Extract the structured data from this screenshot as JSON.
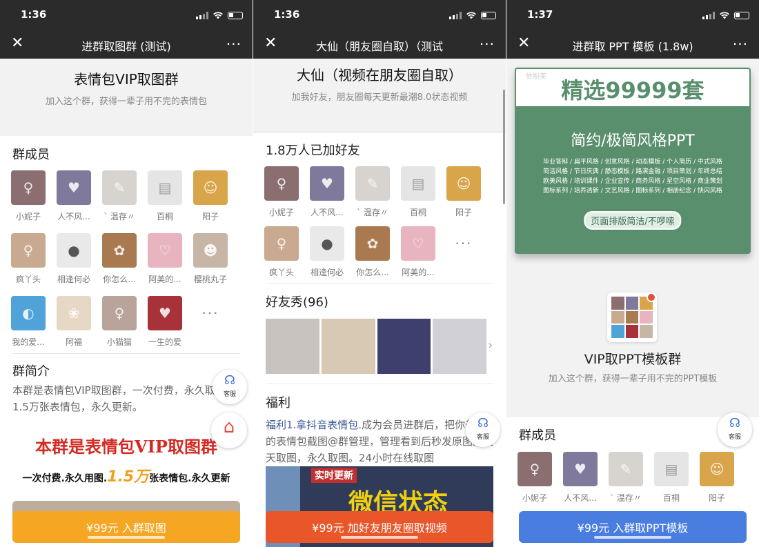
{
  "phones": [
    {
      "time": "1:36",
      "title": "进群取图群 (测试)",
      "hero_title": "表情包VIP取图群",
      "hero_sub": "加入这个群，获得一辈子用不完的表情包",
      "members_heading": "群成员",
      "members": [
        "小妮子",
        "人不风...",
        "` 温存〃",
        "百桐",
        "阳子",
        "疯丫头",
        "相逢何必",
        "你怎么...",
        "阿美的...",
        "樱桃丸子",
        "我的爱...",
        "阿福",
        "小猫猫",
        "一生的爱"
      ],
      "intro_heading": "群简介",
      "intro_text": "本群是表情包VIP取图群，一次付费，永久取图。1.5万张表情包，永久更新。",
      "banner_line1": "本群是表情包VIP取图群",
      "banner_line2a": "一次付费.永久用图.",
      "banner_line2b": "1.5万",
      "banner_line2c": "张表情包.永久更新",
      "service_label": "客服",
      "cta": "¥99元 入群取图",
      "cta_color": "#f5a623"
    },
    {
      "time": "1:36",
      "title": "大仙（朋友圈自取）（测试",
      "hero_title": "大仙（视频在朋友圈自取）",
      "hero_sub": "加我好友，朋友圈每天更新最潮8.0状态视频",
      "members_heading": "1.8万人已加好友",
      "members": [
        "小妮子",
        "人不风...",
        "` 温存〃",
        "百桐",
        "阳子",
        "疯丫头",
        "相逢何必",
        "你怎么...",
        "阿美的..."
      ],
      "show_heading": "好友秀(96)",
      "welfare_heading": "福利",
      "welfare_link": "福利1.拿抖音表情包.",
      "welfare_text": "成为会员进群后，把你想取的表情包截图@群管理，管理看到后秒发原图。天天取图，永久取图。24小时在线取图",
      "banner_tag": "实时更新",
      "banner_big": "微信状态",
      "service_label": "客服",
      "cta": "¥99元 加好友朋友圈取视频",
      "cta_color": "#e8562a"
    },
    {
      "time": "1:37",
      "title": "进群取 PPT 模板 (1.8w)",
      "poster_title": "精选99999套",
      "poster_sub": "简约/极简风格PPT",
      "poster_lines": [
        "毕业答辩 / 扁平风格 / 创意风格 / 动态模板 / 个人简历 / 中式风格",
        "简洁风格 / 节日庆典 / 静态模板 / 路演金融 / 项目策划 / 年终总结",
        "欧美风格 / 培训课件 / 企业宣传 / 商务风格 / 星空风格 / 商业策划",
        "图标系列 / 培养清新 / 文艺风格 / 图标系列 / 相册纪念 / 快闪风格"
      ],
      "poster_pill": "页面排版简洁/不啰嗦",
      "poster_watermark": "依制美",
      "group_name": "VIP取PPT模板群",
      "group_sub": "加入这个群，获得一辈子用不完的PPT模板",
      "members_heading": "群成员",
      "members": [
        "小妮子",
        "人不风...",
        "` 温存〃",
        "百桐",
        "阳子"
      ],
      "service_label": "客服",
      "cta": "¥99元 入群取PPT模板",
      "cta_color": "#4a7de0"
    }
  ],
  "more_glyph": "···",
  "close_glyph": "✕",
  "next_glyph": "›"
}
